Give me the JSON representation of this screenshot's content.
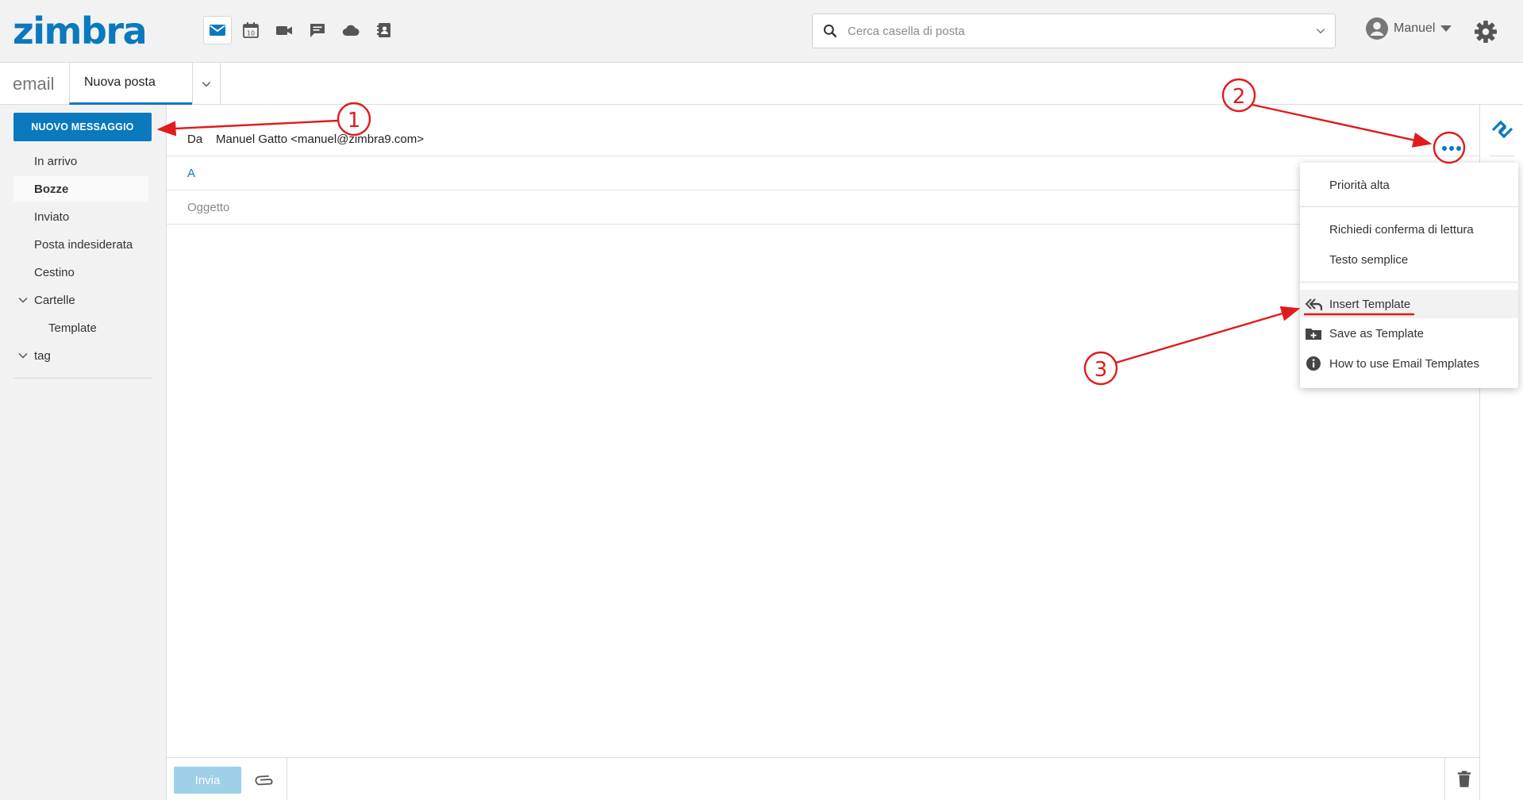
{
  "app": {
    "logo": "zimbra"
  },
  "header": {
    "apps": [
      {
        "name": "mail-app-icon",
        "active": true
      },
      {
        "name": "calendar-app-icon",
        "active": false
      },
      {
        "name": "video-app-icon",
        "active": false
      },
      {
        "name": "chat-app-icon",
        "active": false
      },
      {
        "name": "cloud-app-icon",
        "active": false
      },
      {
        "name": "contacts-app-icon",
        "active": false
      }
    ],
    "calendar_day": "10",
    "search_placeholder": "Cerca casella di posta",
    "user_name": "Manuel"
  },
  "tabbar": {
    "module_label": "email",
    "active_tab": "Nuova posta"
  },
  "sidebar": {
    "new_message": "NUOVO MESSAGGIO",
    "folders": [
      {
        "label": "In arrivo",
        "active": false
      },
      {
        "label": "Bozze",
        "active": true
      },
      {
        "label": "Inviato",
        "active": false
      },
      {
        "label": "Posta indesiderata",
        "active": false
      },
      {
        "label": "Cestino",
        "active": false
      }
    ],
    "groups": {
      "cartelle": "Cartelle",
      "template": "Template",
      "tag": "tag"
    }
  },
  "compose": {
    "from_label": "Da",
    "from_value": "Manuel Gatto <manuel@zimbra9.com>",
    "to_label": "A",
    "subject_placeholder": "Oggetto",
    "send_label": "Invia"
  },
  "menu": {
    "items": [
      {
        "label": "Priorità alta"
      },
      {
        "label": "Richiedi conferma di lettura"
      },
      {
        "label": "Testo semplice"
      },
      {
        "label": "Insert Template",
        "icon": "reply-all-icon",
        "highlighted": true
      },
      {
        "label": "Save as Template",
        "icon": "folder-add-icon"
      },
      {
        "label": "How to use Email Templates",
        "icon": "info-icon"
      }
    ]
  },
  "annotations": {
    "one": "1",
    "two": "2",
    "three": "3",
    "color": "#e01b1b"
  },
  "colors": {
    "accent": "#0b79be",
    "header_bg": "#f2f2f2",
    "send_disabled": "#9fd0e8"
  }
}
